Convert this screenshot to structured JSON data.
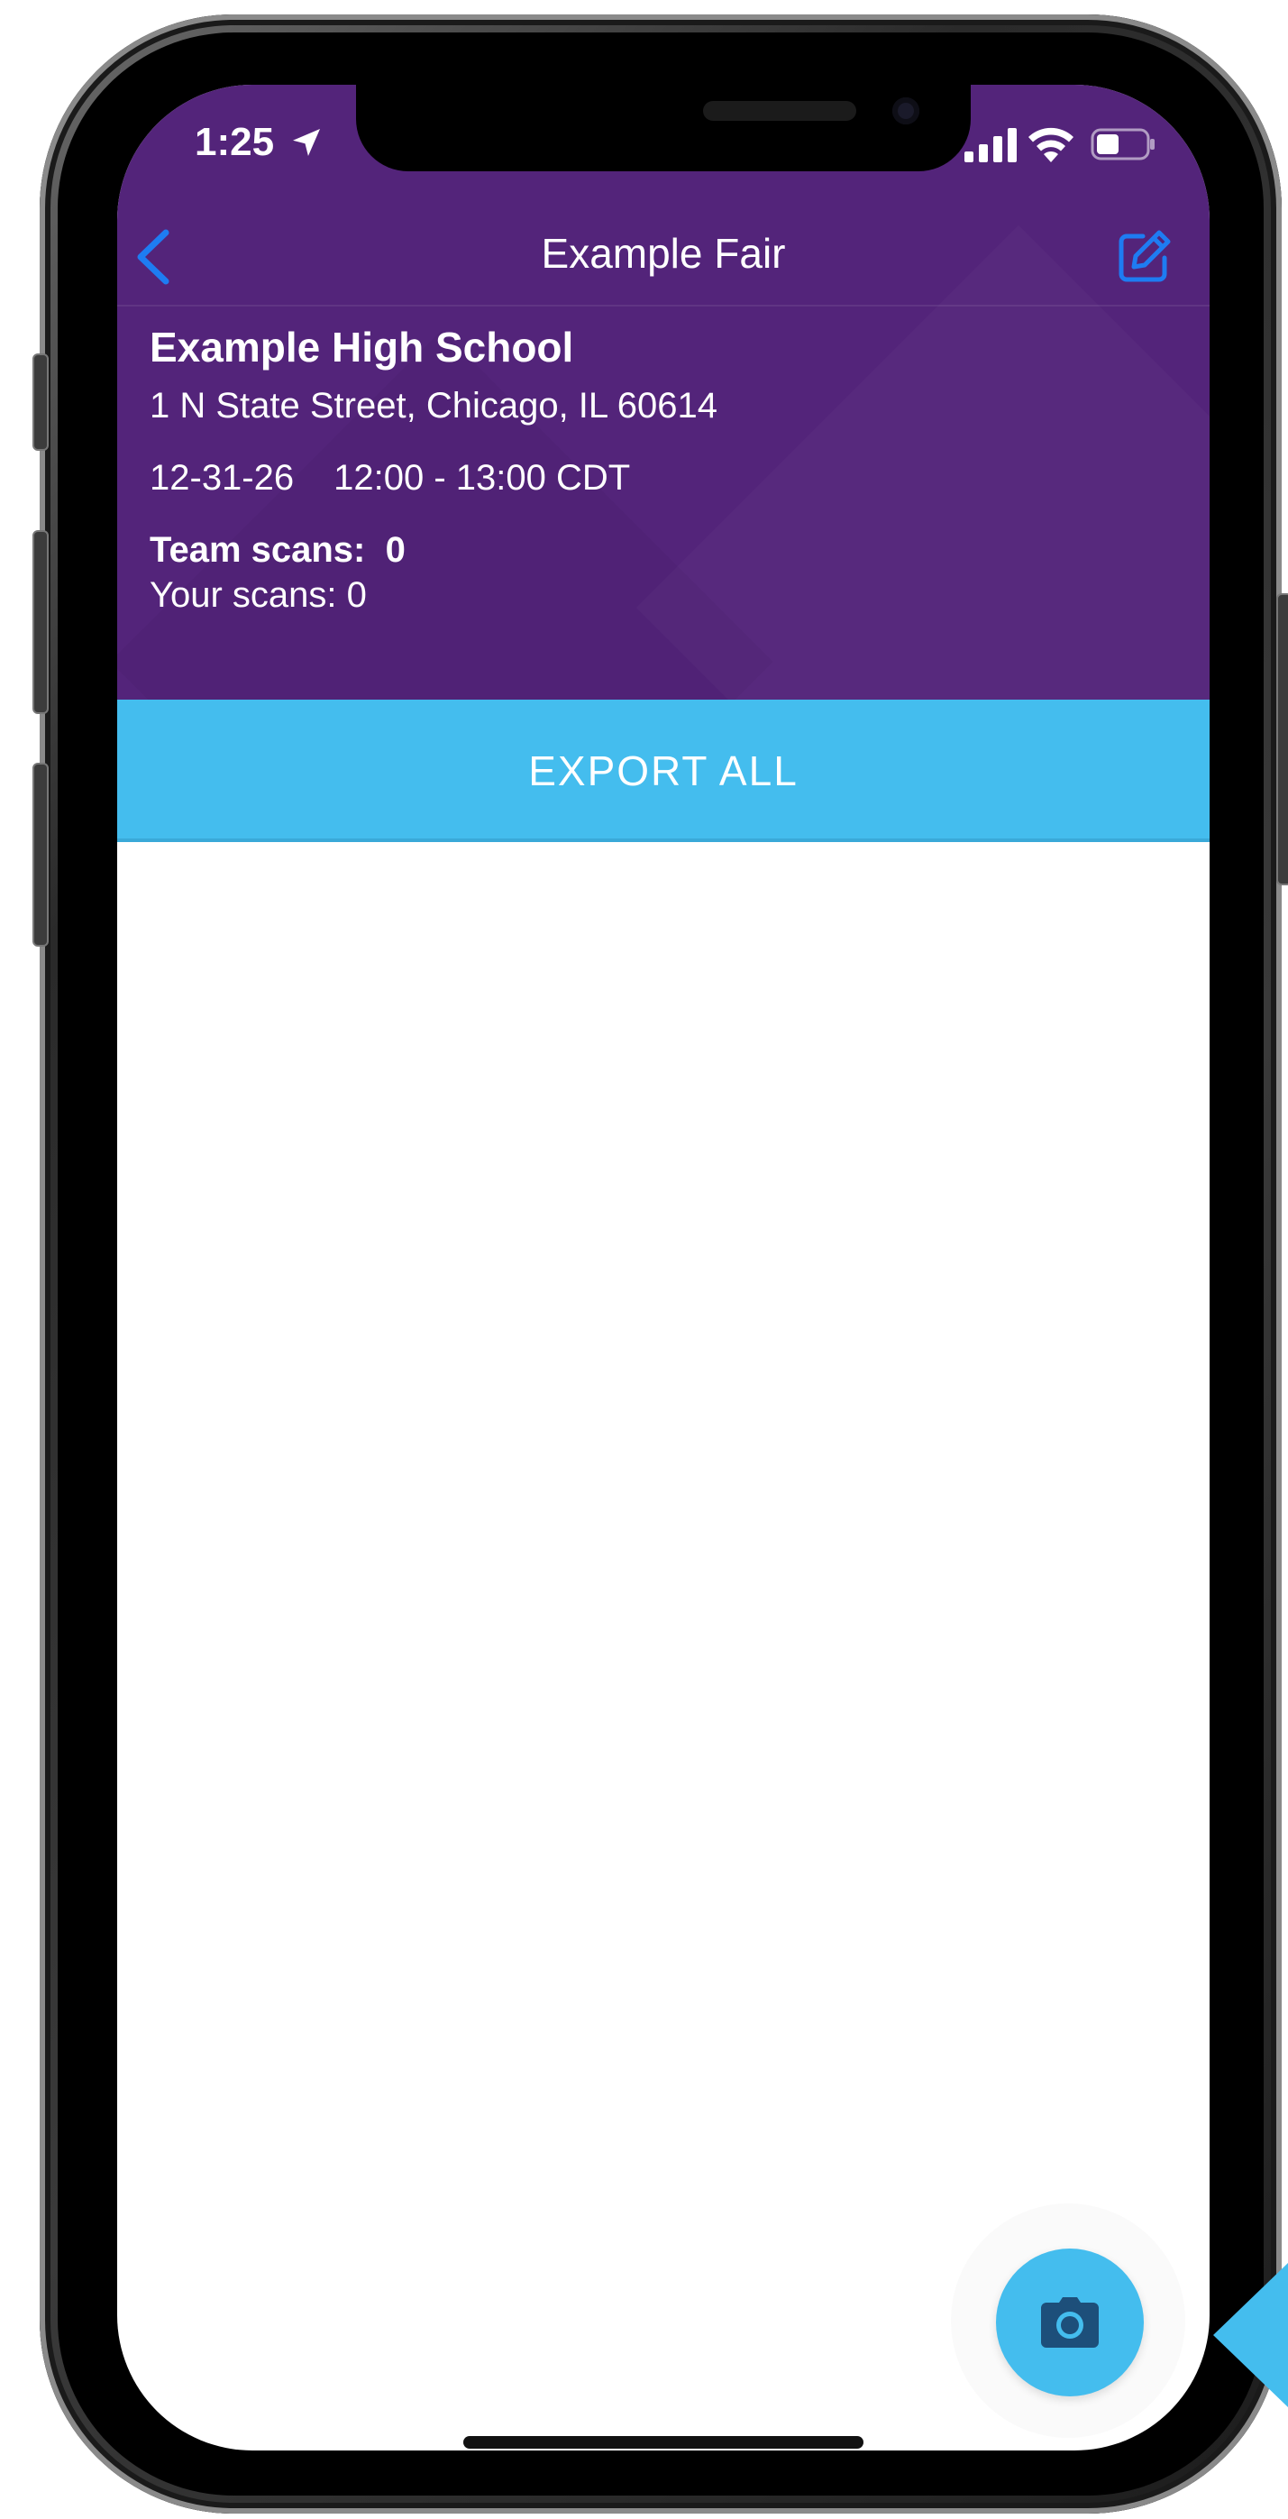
{
  "status_bar": {
    "time": "1:25"
  },
  "nav": {
    "title": "Example Fair"
  },
  "event": {
    "school_name": "Example High School",
    "address": "1 N State Street, Chicago, IL 60614",
    "date": "12-31-26",
    "time_range": "12:00 - 13:00 CDT",
    "team_scans": "Team scans:  0",
    "your_scans": "Your scans: 0"
  },
  "actions": {
    "export_label": "EXPORT ALL"
  },
  "icons": {
    "back": "chevron-left-icon",
    "edit": "edit-icon",
    "camera": "camera-icon",
    "location": "location-arrow-icon",
    "signal": "cellular-signal-icon",
    "wifi": "wifi-icon",
    "battery": "battery-icon"
  },
  "colors": {
    "header_purple": "#53247a",
    "accent_blue": "#44bdee",
    "ios_blue": "#1e7cf2",
    "camera_glyph": "#1d4f7a"
  }
}
